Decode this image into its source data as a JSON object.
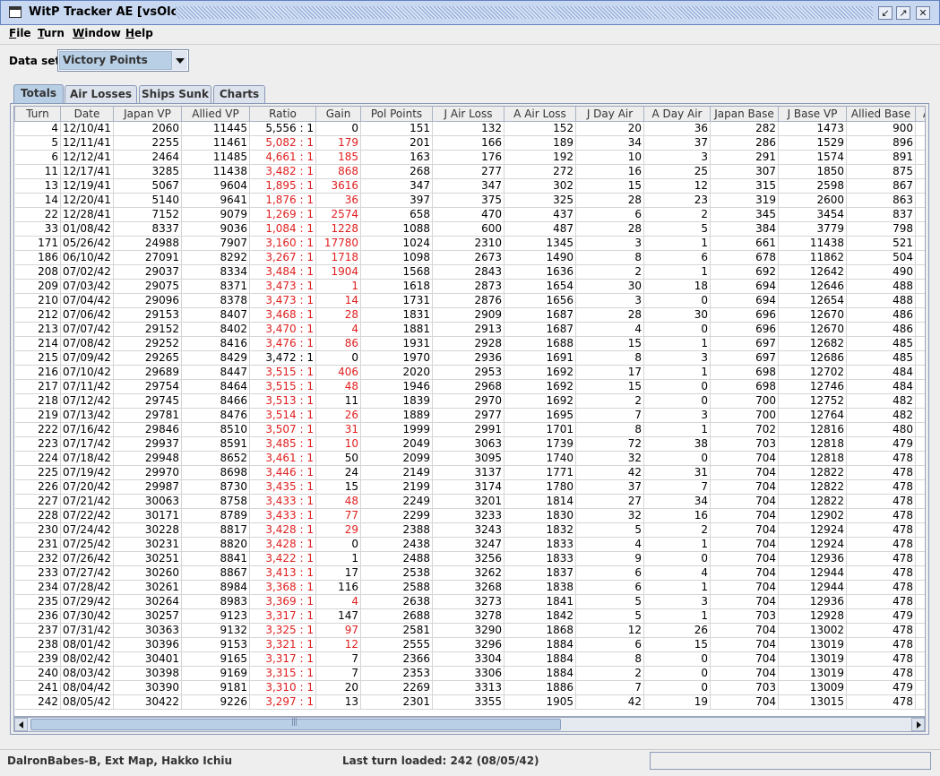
{
  "window": {
    "title": "WitP Tracker AE [vsOlorin]"
  },
  "menu": [
    "File",
    "Turn",
    "Window",
    "Help"
  ],
  "dataset": {
    "label": "Data set:",
    "value": "Victory Points"
  },
  "tabs": [
    {
      "label": "Totals",
      "active": true
    },
    {
      "label": "Air Losses",
      "active": false
    },
    {
      "label": "Ships Sunk",
      "active": false
    },
    {
      "label": "Charts",
      "active": false
    }
  ],
  "table": {
    "columns": [
      "Turn",
      "Date",
      "Japan VP",
      "Allied VP",
      "Ratio",
      "Gain",
      "Pol Points",
      "J Air Loss",
      "A Air Loss",
      "J Day Air",
      "A Day Air",
      "Japan Base",
      "J Base VP",
      "Allied Base",
      "A"
    ],
    "rows": [
      [
        "4",
        "12/10/41",
        "2060",
        "11445",
        "5,556 : 1",
        "0",
        "151",
        "132",
        "152",
        "20",
        "36",
        "282",
        "1473",
        "900"
      ],
      [
        "5",
        "12/11/41",
        "2255",
        "11461",
        "5,082 : 1",
        "179",
        "201",
        "166",
        "189",
        "34",
        "37",
        "286",
        "1529",
        "896"
      ],
      [
        "6",
        "12/12/41",
        "2464",
        "11485",
        "4,661 : 1",
        "185",
        "163",
        "176",
        "192",
        "10",
        "3",
        "291",
        "1574",
        "891"
      ],
      [
        "11",
        "12/17/41",
        "3285",
        "11438",
        "3,482 : 1",
        "868",
        "268",
        "277",
        "272",
        "16",
        "25",
        "307",
        "1850",
        "875"
      ],
      [
        "13",
        "12/19/41",
        "5067",
        "9604",
        "1,895 : 1",
        "3616",
        "347",
        "347",
        "302",
        "15",
        "12",
        "315",
        "2598",
        "867"
      ],
      [
        "14",
        "12/20/41",
        "5140",
        "9641",
        "1,876 : 1",
        "36",
        "397",
        "375",
        "325",
        "28",
        "23",
        "319",
        "2600",
        "863"
      ],
      [
        "22",
        "12/28/41",
        "7152",
        "9079",
        "1,269 : 1",
        "2574",
        "658",
        "470",
        "437",
        "6",
        "2",
        "345",
        "3454",
        "837"
      ],
      [
        "33",
        "01/08/42",
        "8337",
        "9036",
        "1,084 : 1",
        "1228",
        "1088",
        "600",
        "487",
        "28",
        "5",
        "384",
        "3779",
        "798"
      ],
      [
        "171",
        "05/26/42",
        "24988",
        "7907",
        "3,160 : 1",
        "17780",
        "1024",
        "2310",
        "1345",
        "3",
        "1",
        "661",
        "11438",
        "521"
      ],
      [
        "186",
        "06/10/42",
        "27091",
        "8292",
        "3,267 : 1",
        "1718",
        "1098",
        "2673",
        "1490",
        "8",
        "6",
        "678",
        "11862",
        "504"
      ],
      [
        "208",
        "07/02/42",
        "29037",
        "8334",
        "3,484 : 1",
        "1904",
        "1568",
        "2843",
        "1636",
        "2",
        "1",
        "692",
        "12642",
        "490"
      ],
      [
        "209",
        "07/03/42",
        "29075",
        "8371",
        "3,473 : 1",
        "1",
        "1618",
        "2873",
        "1654",
        "30",
        "18",
        "694",
        "12646",
        "488"
      ],
      [
        "210",
        "07/04/42",
        "29096",
        "8378",
        "3,473 : 1",
        "14",
        "1731",
        "2876",
        "1656",
        "3",
        "0",
        "694",
        "12654",
        "488"
      ],
      [
        "212",
        "07/06/42",
        "29153",
        "8407",
        "3,468 : 1",
        "28",
        "1831",
        "2909",
        "1687",
        "28",
        "30",
        "696",
        "12670",
        "486"
      ],
      [
        "213",
        "07/07/42",
        "29152",
        "8402",
        "3,470 : 1",
        "4",
        "1881",
        "2913",
        "1687",
        "4",
        "0",
        "696",
        "12670",
        "486"
      ],
      [
        "214",
        "07/08/42",
        "29252",
        "8416",
        "3,476 : 1",
        "86",
        "1931",
        "2928",
        "1688",
        "15",
        "1",
        "697",
        "12682",
        "485"
      ],
      [
        "215",
        "07/09/42",
        "29265",
        "8429",
        "3,472 : 1",
        "0",
        "1970",
        "2936",
        "1691",
        "8",
        "3",
        "697",
        "12686",
        "485"
      ],
      [
        "216",
        "07/10/42",
        "29689",
        "8447",
        "3,515 : 1",
        "406",
        "2020",
        "2953",
        "1692",
        "17",
        "1",
        "698",
        "12702",
        "484"
      ],
      [
        "217",
        "07/11/42",
        "29754",
        "8464",
        "3,515 : 1",
        "48",
        "1946",
        "2968",
        "1692",
        "15",
        "0",
        "698",
        "12746",
        "484"
      ],
      [
        "218",
        "07/12/42",
        "29745",
        "8466",
        "3,513 : 1",
        "11",
        "1839",
        "2970",
        "1692",
        "2",
        "0",
        "700",
        "12752",
        "482"
      ],
      [
        "219",
        "07/13/42",
        "29781",
        "8476",
        "3,514 : 1",
        "26",
        "1889",
        "2977",
        "1695",
        "7",
        "3",
        "700",
        "12764",
        "482"
      ],
      [
        "222",
        "07/16/42",
        "29846",
        "8510",
        "3,507 : 1",
        "31",
        "1999",
        "2991",
        "1701",
        "8",
        "1",
        "702",
        "12816",
        "480"
      ],
      [
        "223",
        "07/17/42",
        "29937",
        "8591",
        "3,485 : 1",
        "10",
        "2049",
        "3063",
        "1739",
        "72",
        "38",
        "703",
        "12818",
        "479"
      ],
      [
        "224",
        "07/18/42",
        "29948",
        "8652",
        "3,461 : 1",
        "50",
        "2099",
        "3095",
        "1740",
        "32",
        "0",
        "704",
        "12818",
        "478"
      ],
      [
        "225",
        "07/19/42",
        "29970",
        "8698",
        "3,446 : 1",
        "24",
        "2149",
        "3137",
        "1771",
        "42",
        "31",
        "704",
        "12822",
        "478"
      ],
      [
        "226",
        "07/20/42",
        "29987",
        "8730",
        "3,435 : 1",
        "15",
        "2199",
        "3174",
        "1780",
        "37",
        "7",
        "704",
        "12822",
        "478"
      ],
      [
        "227",
        "07/21/42",
        "30063",
        "8758",
        "3,433 : 1",
        "48",
        "2249",
        "3201",
        "1814",
        "27",
        "34",
        "704",
        "12822",
        "478"
      ],
      [
        "228",
        "07/22/42",
        "30171",
        "8789",
        "3,433 : 1",
        "77",
        "2299",
        "3233",
        "1830",
        "32",
        "16",
        "704",
        "12902",
        "478"
      ],
      [
        "230",
        "07/24/42",
        "30228",
        "8817",
        "3,428 : 1",
        "29",
        "2388",
        "3243",
        "1832",
        "5",
        "2",
        "704",
        "12924",
        "478"
      ],
      [
        "231",
        "07/25/42",
        "30231",
        "8820",
        "3,428 : 1",
        "0",
        "2438",
        "3247",
        "1833",
        "4",
        "1",
        "704",
        "12924",
        "478"
      ],
      [
        "232",
        "07/26/42",
        "30251",
        "8841",
        "3,422 : 1",
        "1",
        "2488",
        "3256",
        "1833",
        "9",
        "0",
        "704",
        "12936",
        "478"
      ],
      [
        "233",
        "07/27/42",
        "30260",
        "8867",
        "3,413 : 1",
        "17",
        "2538",
        "3262",
        "1837",
        "6",
        "4",
        "704",
        "12944",
        "478"
      ],
      [
        "234",
        "07/28/42",
        "30261",
        "8984",
        "3,368 : 1",
        "116",
        "2588",
        "3268",
        "1838",
        "6",
        "1",
        "704",
        "12944",
        "478"
      ],
      [
        "235",
        "07/29/42",
        "30264",
        "8983",
        "3,369 : 1",
        "4",
        "2638",
        "3273",
        "1841",
        "5",
        "3",
        "704",
        "12936",
        "478"
      ],
      [
        "236",
        "07/30/42",
        "30257",
        "9123",
        "3,317 : 1",
        "147",
        "2688",
        "3278",
        "1842",
        "5",
        "1",
        "703",
        "12928",
        "479"
      ],
      [
        "237",
        "07/31/42",
        "30363",
        "9132",
        "3,325 : 1",
        "97",
        "2581",
        "3290",
        "1868",
        "12",
        "26",
        "704",
        "13002",
        "478"
      ],
      [
        "238",
        "08/01/42",
        "30396",
        "9153",
        "3,321 : 1",
        "12",
        "2555",
        "3296",
        "1884",
        "6",
        "15",
        "704",
        "13019",
        "478"
      ],
      [
        "239",
        "08/02/42",
        "30401",
        "9165",
        "3,317 : 1",
        "7",
        "2366",
        "3304",
        "1884",
        "8",
        "0",
        "704",
        "13019",
        "478"
      ],
      [
        "240",
        "08/03/42",
        "30398",
        "9169",
        "3,315 : 1",
        "7",
        "2353",
        "3306",
        "1884",
        "2",
        "0",
        "704",
        "13019",
        "478"
      ],
      [
        "241",
        "08/04/42",
        "30390",
        "9181",
        "3,310 : 1",
        "20",
        "2269",
        "3313",
        "1886",
        "7",
        "0",
        "703",
        "13009",
        "479"
      ],
      [
        "242",
        "08/05/42",
        "30422",
        "9226",
        "3,297 : 1",
        "13",
        "2301",
        "3355",
        "1905",
        "42",
        "19",
        "704",
        "13015",
        "478"
      ]
    ],
    "red_rows": [
      1,
      2,
      3,
      4,
      5,
      6,
      7,
      8,
      9,
      10,
      11,
      12,
      13,
      14,
      15,
      17,
      18,
      19,
      20,
      21,
      22,
      23,
      24,
      25,
      26,
      27,
      28,
      29,
      30,
      31,
      32,
      33,
      34,
      35,
      36,
      37,
      38,
      39,
      40
    ],
    "red_gain_rows": [
      1,
      2,
      3,
      4,
      5,
      6,
      7,
      8,
      9,
      10,
      11,
      12,
      13,
      14,
      15,
      17,
      18,
      20,
      21,
      22,
      26,
      27,
      28,
      33,
      35,
      36
    ],
    "text_color_alert": "#e02020"
  },
  "status": {
    "left": "DalronBabes-B, Ext Map, Hakko Ichiu",
    "center": "Last turn loaded: 242 (08/05/42)"
  }
}
